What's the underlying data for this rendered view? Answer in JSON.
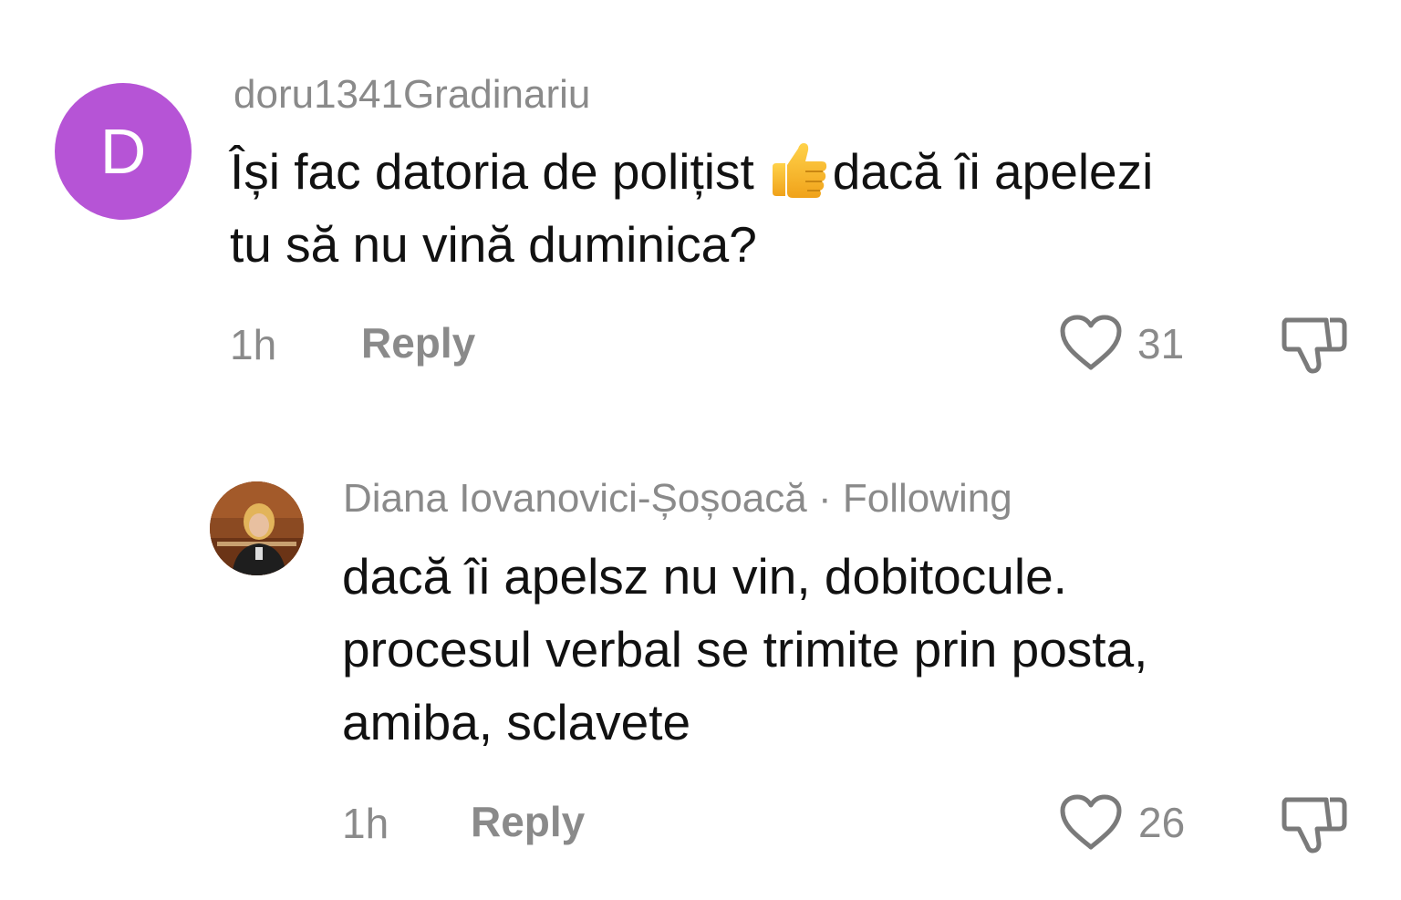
{
  "comments": [
    {
      "avatar_letter": "D",
      "avatar_color": "#b654d6",
      "username": "doru1341Gradinariu",
      "text_line1_before_emoji": "Își fac datoria de polițist",
      "emoji": "thumbs-up",
      "text_line1_after_emoji": "dacă îi apelezi",
      "text_line2": "tu să nu vină duminica?",
      "time": "1h",
      "reply_label": "Reply",
      "like_count": "31"
    },
    {
      "avatar": "profile-photo",
      "username": "Diana Iovanovici-Șoșoacă",
      "separator": "·",
      "following_label": "Following",
      "text_lines": [
        "dacă îi apelsz nu vin, dobitocule.",
        "procesul verbal se trimite prin posta,",
        "amiba, sclavete"
      ],
      "time": "1h",
      "reply_label": "Reply",
      "like_count": "26"
    }
  ],
  "colors": {
    "meta_gray": "#8a8a8a",
    "text": "#111111",
    "background": "#ffffff"
  },
  "icons": [
    "heart-icon",
    "thumbs-down-icon",
    "thumbs-up-emoji"
  ]
}
